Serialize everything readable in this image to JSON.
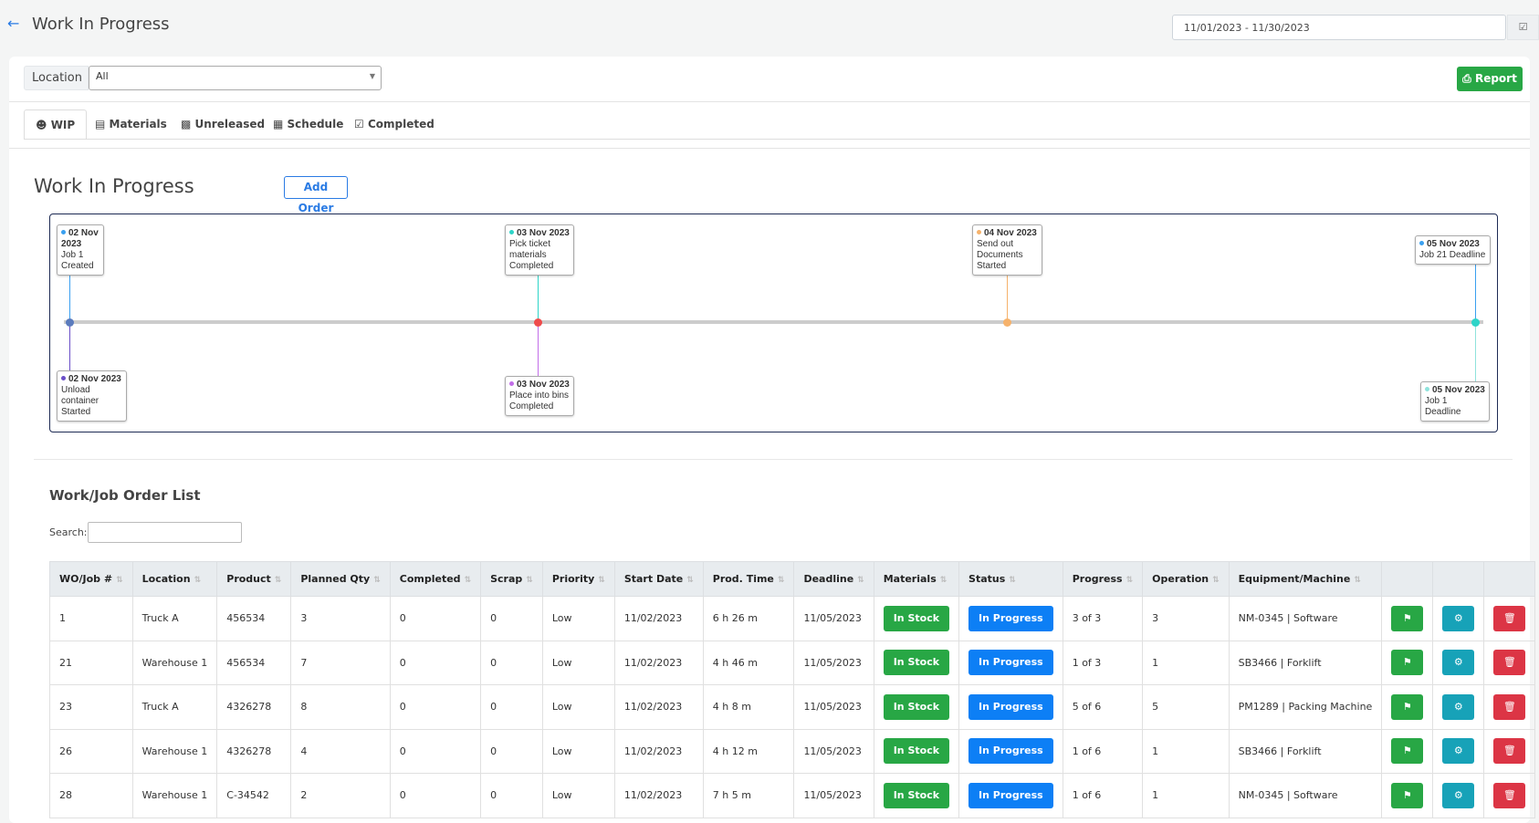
{
  "header": {
    "back_icon": "arrow-left-icon",
    "title": "Work In Progress",
    "date_range": "11/01/2023 - 11/30/2023",
    "calendar_icon": "calendar-check-icon"
  },
  "filter": {
    "location_label": "Location",
    "location_value": "All",
    "report_label": "Report",
    "report_icon": "print-icon"
  },
  "tabs": [
    {
      "label": "WIP",
      "icon": "users-icon",
      "active": true
    },
    {
      "label": "Materials",
      "icon": "warehouse-icon"
    },
    {
      "label": "Unreleased",
      "icon": "lock-icon"
    },
    {
      "label": "Schedule",
      "icon": "calendar-icon"
    },
    {
      "label": "Completed",
      "icon": "calendar-check-icon"
    }
  ],
  "section": {
    "title": "Work In Progress",
    "add_order": "Add Order"
  },
  "timeline": {
    "points": [
      {
        "date": "02 Nov 2023",
        "color": "#5b7bbd"
      },
      {
        "date": "03 Nov 2023",
        "color": "#ef4b4b"
      },
      {
        "date": "04 Nov 2023",
        "color": "#f6b26b"
      },
      {
        "date": "05 Nov 2023",
        "color": "#2dd4c8"
      }
    ],
    "events": [
      {
        "date": "02 Nov 2023",
        "lines": [
          "Job 1",
          "Created"
        ],
        "pos": "top",
        "color": "#3aa0f0",
        "point": 0
      },
      {
        "date": "02 Nov 2023",
        "lines": [
          "Unload",
          "container",
          "Started"
        ],
        "pos": "bottom",
        "color": "#6a4fc8",
        "point": 0
      },
      {
        "date": "03 Nov 2023",
        "lines": [
          "Pick ticket",
          "materials",
          "Completed"
        ],
        "pos": "top",
        "color": "#2dd4c8",
        "point": 1
      },
      {
        "date": "03 Nov 2023",
        "lines": [
          "Place into bins",
          "Completed"
        ],
        "pos": "bottom",
        "color": "#c26ee8",
        "point": 1
      },
      {
        "date": "04 Nov 2023",
        "lines": [
          "Send out",
          "Documents",
          "Started"
        ],
        "pos": "top",
        "color": "#f6b26b",
        "point": 2
      },
      {
        "date": "05 Nov 2023",
        "lines": [
          "Job 21 Deadline"
        ],
        "pos": "top",
        "color": "#3aa0f0",
        "point": 3
      },
      {
        "date": "05 Nov 2023",
        "lines": [
          "Job 1 Deadline"
        ],
        "pos": "bottom",
        "color": "#8fe3dc",
        "point": 3
      }
    ]
  },
  "list": {
    "title": "Work/Job Order List",
    "search_label": "Search:",
    "search_value": "",
    "columns": [
      "WO/Job #",
      "Location",
      "Product",
      "Planned Qty",
      "Completed",
      "Scrap",
      "Priority",
      "Start Date",
      "Prod. Time",
      "Deadline",
      "Materials",
      "Status",
      "Progress",
      "Operation",
      "Equipment/Machine",
      "",
      "",
      ""
    ],
    "rows": [
      [
        "1",
        "Truck A",
        "456534",
        "3",
        "0",
        "0",
        "Low",
        "11/02/2023",
        "6 h 26 m",
        "11/05/2023",
        "In Stock",
        "In Progress",
        "3 of 3",
        "3",
        "NM-0345 | Software"
      ],
      [
        "21",
        "Warehouse 1",
        "456534",
        "7",
        "0",
        "0",
        "Low",
        "11/02/2023",
        "4 h 46 m",
        "11/05/2023",
        "In Stock",
        "In Progress",
        "1 of 3",
        "1",
        "SB3466 | Forklift"
      ],
      [
        "23",
        "Truck A",
        "4326278",
        "8",
        "0",
        "0",
        "Low",
        "11/02/2023",
        "4 h 8 m",
        "11/05/2023",
        "In Stock",
        "In Progress",
        "5 of 6",
        "5",
        "PM1289 | Packing Machine"
      ],
      [
        "26",
        "Warehouse 1",
        "4326278",
        "4",
        "0",
        "0",
        "Low",
        "11/02/2023",
        "4 h 12 m",
        "11/05/2023",
        "In Stock",
        "In Progress",
        "1 of 6",
        "1",
        "SB3466 | Forklift"
      ],
      [
        "28",
        "Warehouse 1",
        "C-34542",
        "2",
        "0",
        "0",
        "Low",
        "11/02/2023",
        "7 h 5 m",
        "11/05/2023",
        "In Stock",
        "In Progress",
        "1 of 6",
        "1",
        "NM-0345 | Software"
      ]
    ],
    "action_icons": [
      "map-icon",
      "cogs-icon",
      "trash-icon"
    ]
  },
  "colors": {
    "green": "#28a745",
    "blue": "#0d7ff5",
    "teal": "#17a2b8",
    "red": "#dc3545"
  }
}
